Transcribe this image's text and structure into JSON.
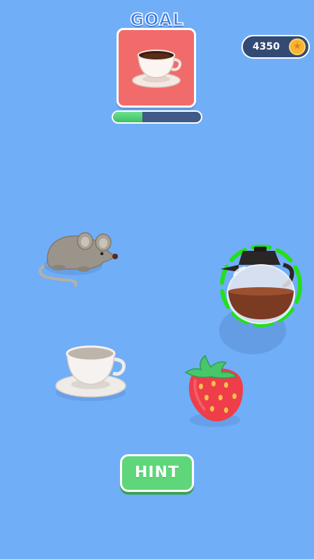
{
  "goal": {
    "label": "GOAL",
    "target_item": "coffee-cup",
    "progress": 0.33
  },
  "hud": {
    "coins": "4350",
    "coin_icon": "star-coin-icon"
  },
  "board": {
    "items": [
      "mouse",
      "coffee-pot",
      "empty-cup",
      "strawberry"
    ],
    "selected_item": "coffee-pot"
  },
  "hint": {
    "label": "HINT"
  },
  "colors": {
    "background": "#70aef8",
    "goal_card": "#f26b6b",
    "progress_fill": "#4fcf75",
    "selection_ring": "#22e01a",
    "hint_button": "#5fd67a"
  }
}
